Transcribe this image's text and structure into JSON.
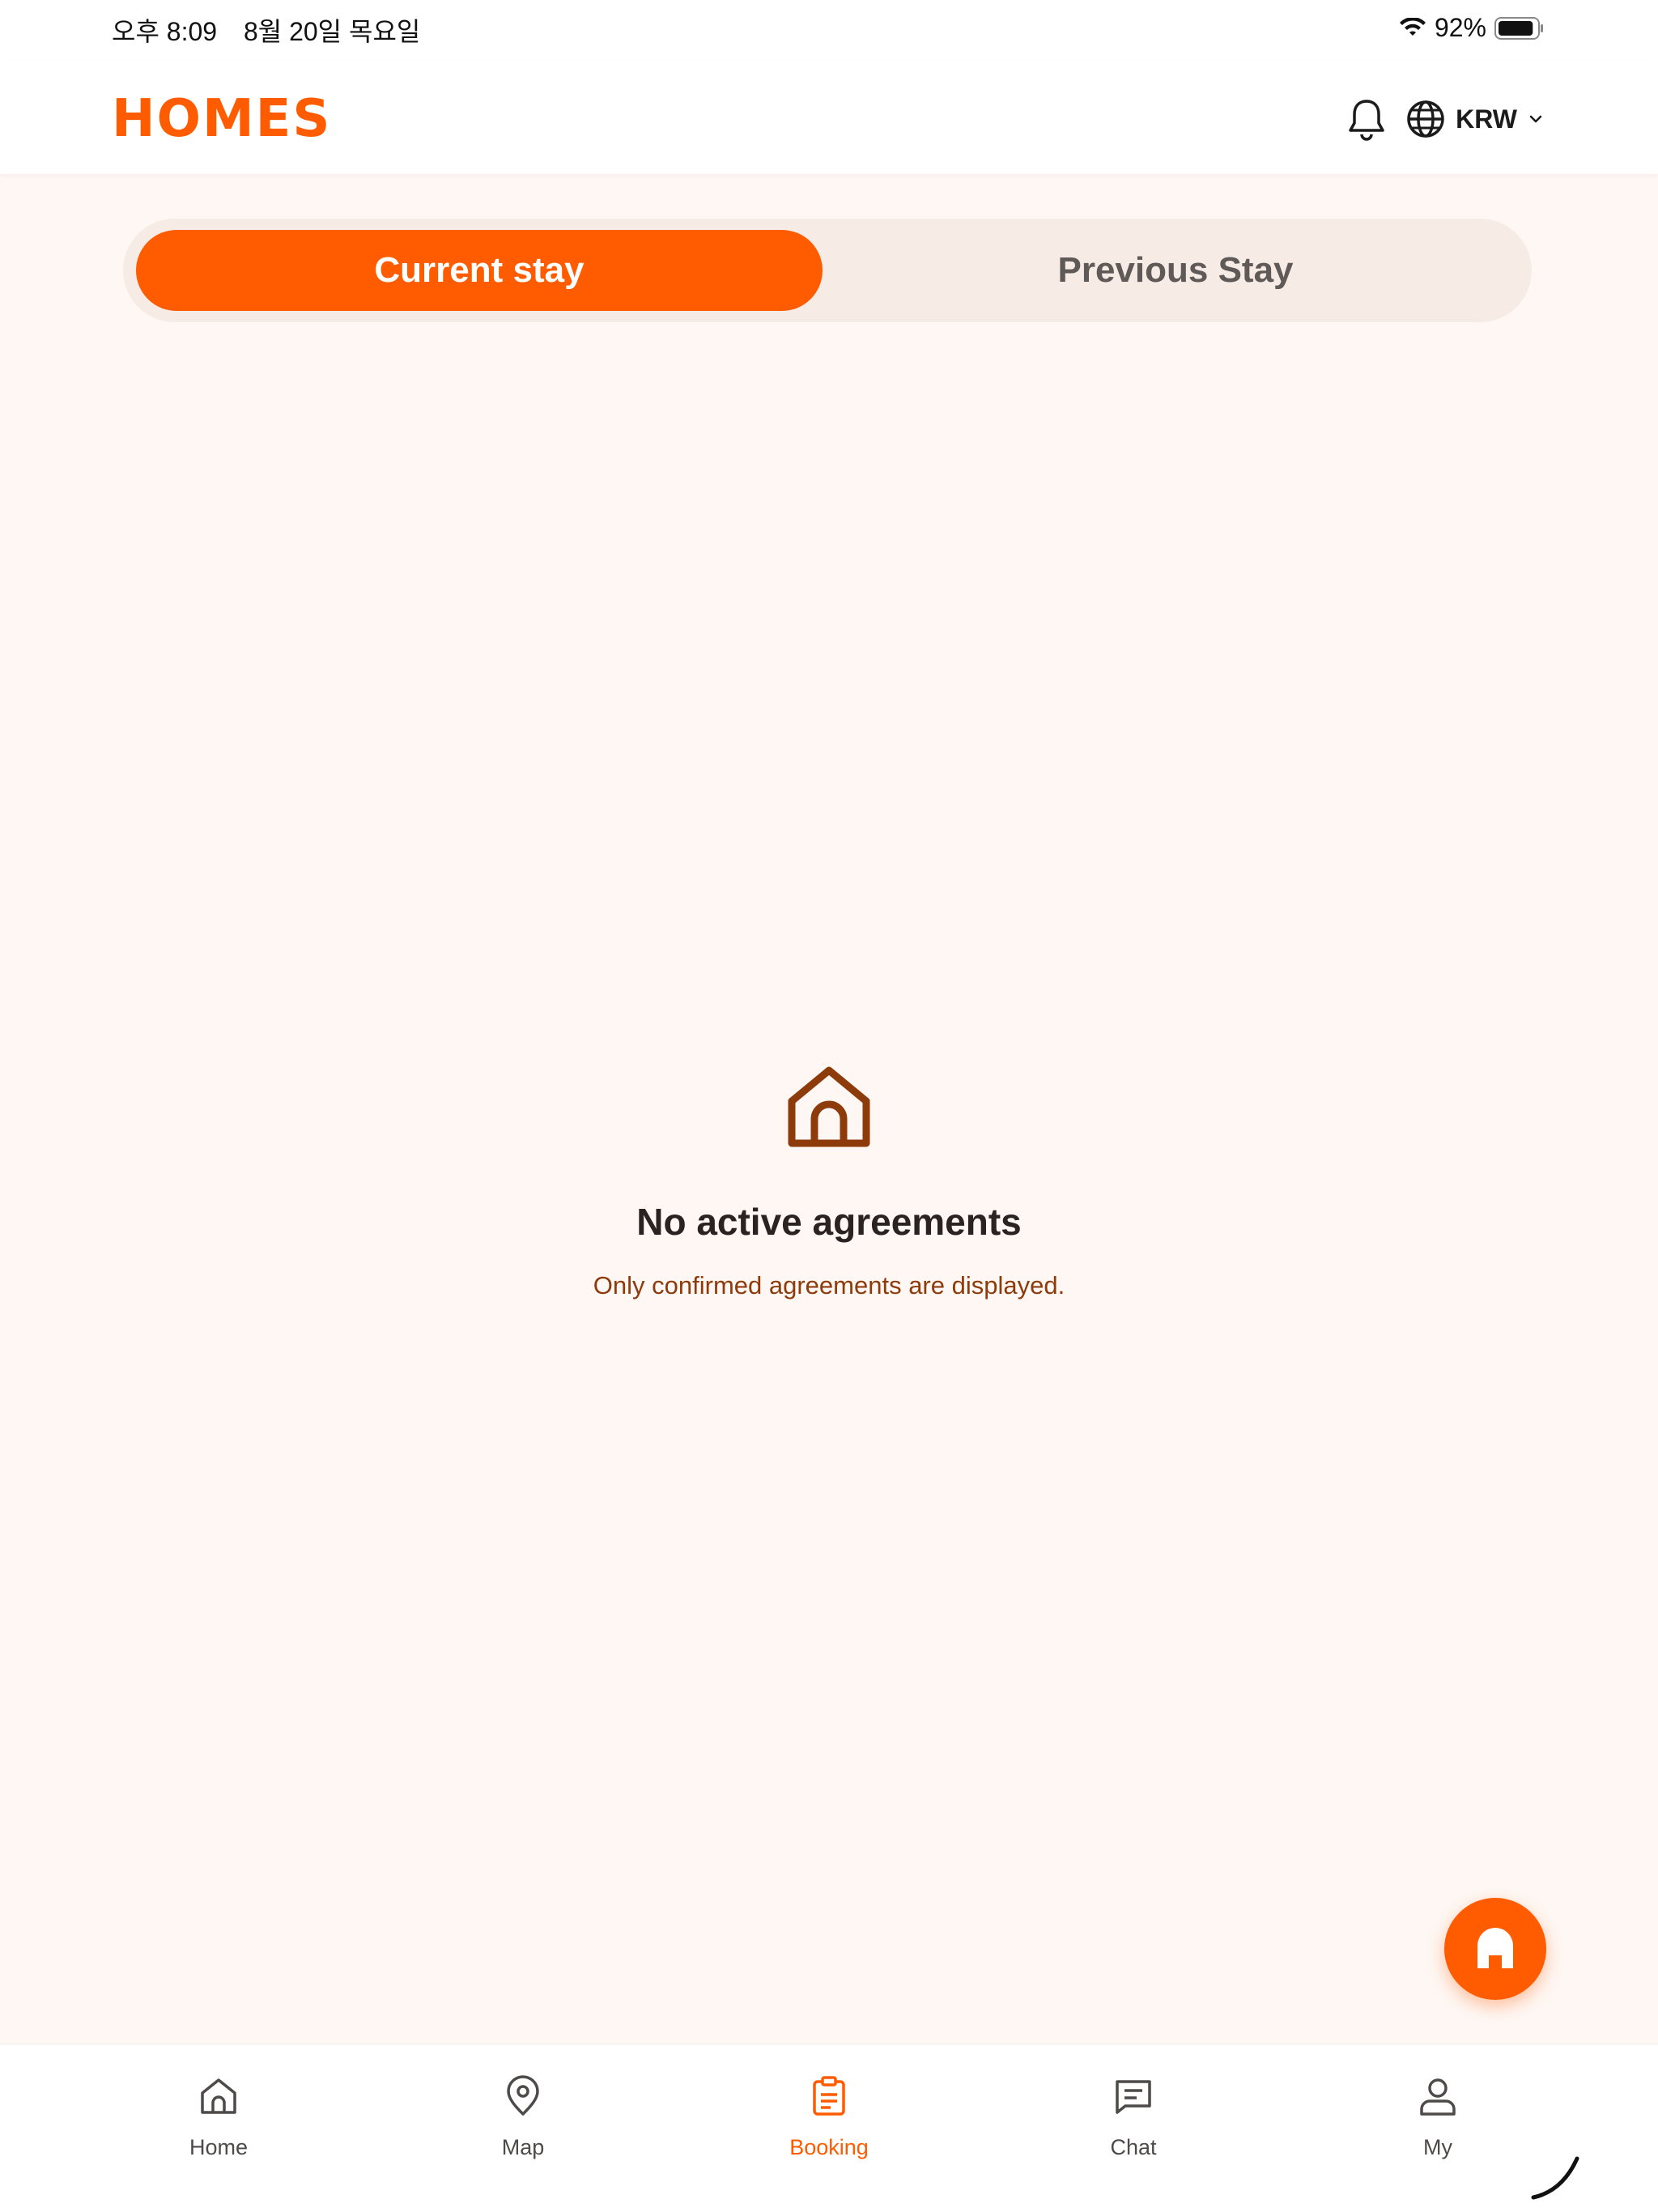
{
  "status_bar": {
    "time": "오후 8:09",
    "date": "8월 20일 목요일",
    "battery_pct": "92%",
    "battery_level": 0.92
  },
  "header": {
    "logo_text": "HOMES",
    "currency": "KRW",
    "icons": [
      "bell-icon",
      "globe-icon",
      "chevron-down-icon"
    ]
  },
  "tabs": [
    {
      "label": "Current stay",
      "active": true
    },
    {
      "label": "Previous Stay",
      "active": false
    }
  ],
  "empty_state": {
    "icon": "house-icon",
    "title": "No active agreements",
    "subtitle": "Only confirmed agreements are displayed."
  },
  "fab": {
    "icon": "homes-logo-icon"
  },
  "bottom_nav": {
    "items": [
      {
        "label": "Home",
        "icon": "home-icon",
        "active": false
      },
      {
        "label": "Map",
        "icon": "map-pin-icon",
        "active": false
      },
      {
        "label": "Booking",
        "icon": "clipboard-icon",
        "active": true
      },
      {
        "label": "Chat",
        "icon": "chat-icon",
        "active": false
      },
      {
        "label": "My",
        "icon": "user-icon",
        "active": false
      }
    ]
  },
  "colors": {
    "accent": "#ff5c01",
    "background": "#fef7f3",
    "tab_track": "#f6ebe5",
    "subtitle": "#8e3b0c",
    "icon_brown": "#8e3b0c"
  }
}
